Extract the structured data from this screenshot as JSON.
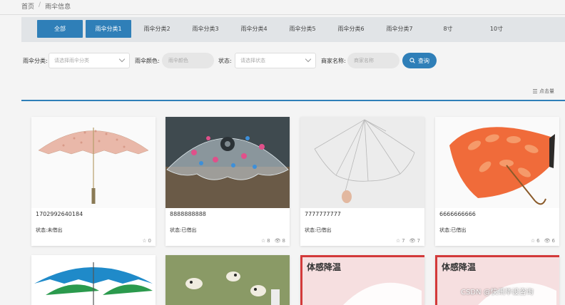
{
  "breadcrumb": {
    "home": "首页",
    "current": "雨伞信息"
  },
  "tabs": [
    {
      "label": "全部"
    },
    {
      "label": "雨伞分类1"
    },
    {
      "label": "雨伞分类2"
    },
    {
      "label": "雨伞分类3"
    },
    {
      "label": "雨伞分类4"
    },
    {
      "label": "雨伞分类5"
    },
    {
      "label": "雨伞分类6"
    },
    {
      "label": "雨伞分类7"
    },
    {
      "label": "8寸"
    },
    {
      "label": "10寸"
    }
  ],
  "filters": {
    "category_label": "雨伞分类:",
    "category_placeholder": "请选择雨伞分类",
    "color_label": "雨伞颜色:",
    "color_placeholder": "雨伞颜色",
    "status_label": "状态:",
    "status_placeholder": "请选择状态",
    "merchant_label": "商家名称:",
    "merchant_placeholder": "商家名称",
    "search_label": "查询"
  },
  "sort_label": "点击量",
  "cards": [
    {
      "id": "1702992640184",
      "status": "状态:未借出",
      "likes": "0",
      "views": ""
    },
    {
      "id": "8888888888",
      "status": "状态:已借出",
      "likes": "8",
      "views": "8"
    },
    {
      "id": "7777777777",
      "status": "状态:已借出",
      "likes": "7",
      "views": "7"
    },
    {
      "id": "6666666666",
      "status": "状态:已借出",
      "likes": "6",
      "views": "6"
    }
  ],
  "bottom_cards": [
    {
      "banner": ""
    },
    {
      "banner": ""
    },
    {
      "banner": "体感降温"
    },
    {
      "banner": "体感降温"
    }
  ],
  "watermark": "CSDN @快讯毕设咨询",
  "colors": {
    "accent": "#2f7fb8"
  }
}
